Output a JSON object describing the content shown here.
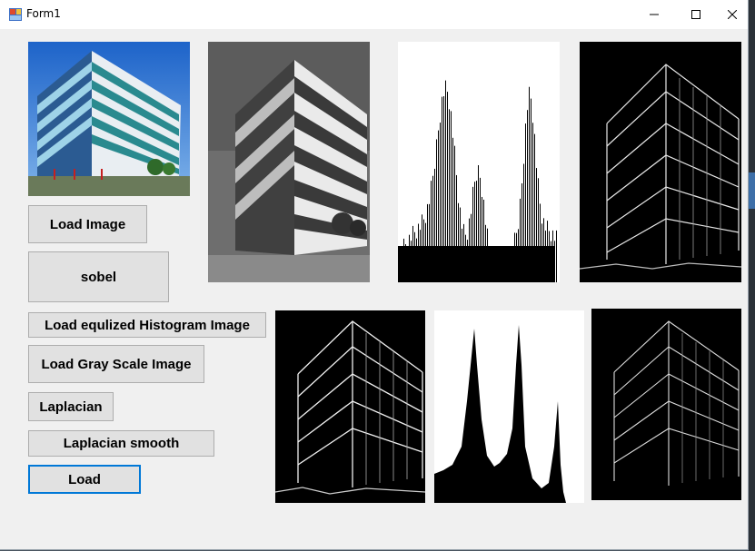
{
  "window": {
    "title": "Form1",
    "minimize_glyph": "–",
    "maximize_glyph": "☐",
    "close_glyph": "✕",
    "accent": "#0078d7"
  },
  "buttons": {
    "load_image": "Load Image",
    "sobel": "sobel",
    "load_equalized": "Load equlized Histogram Image",
    "load_gray": "Load Gray Scale Image",
    "laplacian": "Laplacian",
    "laplacian_smooth": "Laplacian smooth",
    "load": "Load"
  },
  "pictures": {
    "original": "original-color-building",
    "grayscale": "grayscale-building",
    "histogram": "histogram",
    "sobel": "sobel-edges",
    "laplacian": "laplacian-edges",
    "equalized_histogram": "equalized-histogram",
    "laplacian_smooth": "laplacian-smooth-edges"
  }
}
